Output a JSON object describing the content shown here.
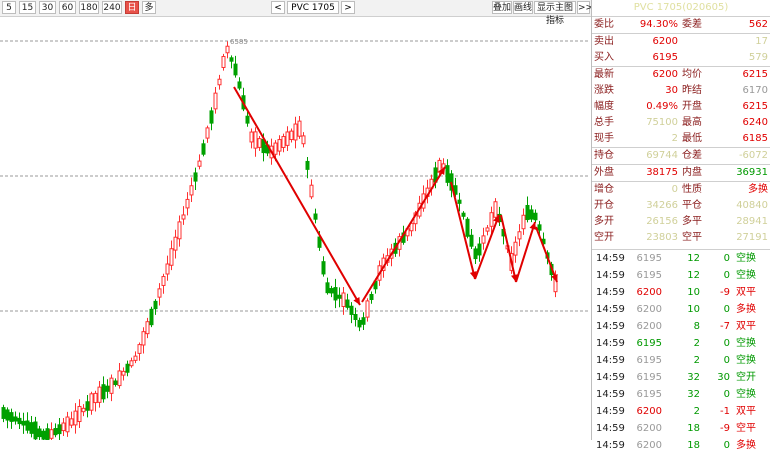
{
  "toolbar": {
    "periods": [
      {
        "label": "5",
        "active": false
      },
      {
        "label": "15",
        "active": false
      },
      {
        "label": "30",
        "active": false
      },
      {
        "label": "60",
        "active": false
      },
      {
        "label": "180",
        "active": false
      },
      {
        "label": "240",
        "active": false
      },
      {
        "label": "日",
        "active": true
      },
      {
        "label": "多",
        "active": false
      }
    ],
    "prev_symbol": "<",
    "symbol": "PVC 1705",
    "next_symbol": ">",
    "overlay_label": "叠加",
    "draw_label": "画线",
    "indicator_label": "显示主图指标",
    "expand_label": ">>"
  },
  "chart": {
    "high_marker": "6585",
    "colors": {
      "up": "#ff3030",
      "down": "#00a000",
      "trend": "#e00000",
      "grid": "#999999"
    }
  },
  "quote": {
    "title": "PVC 1705(020605)",
    "rows": [
      {
        "l1": "委比",
        "v1": "94.30%",
        "c1": "red",
        "l2": "委差",
        "v2": "562",
        "c2": "red",
        "sep": false
      },
      {
        "l1": "卖出",
        "v1": "6200",
        "c1": "red",
        "l2": "",
        "v2": "17",
        "c2": "yellow",
        "sep": true
      },
      {
        "l1": "买入",
        "v1": "6195",
        "c1": "red",
        "l2": "",
        "v2": "579",
        "c2": "yellow",
        "sep": false
      },
      {
        "l1": "最新",
        "v1": "6200",
        "c1": "red",
        "l2": "均价",
        "v2": "6215",
        "c2": "red",
        "sep": true
      },
      {
        "l1": "涨跌",
        "v1": "30",
        "c1": "red",
        "l2": "昨结",
        "v2": "6170",
        "c2": "grey",
        "sep": false
      },
      {
        "l1": "幅度",
        "v1": "0.49%",
        "c1": "red",
        "l2": "开盘",
        "v2": "6215",
        "c2": "red",
        "sep": false
      },
      {
        "l1": "总手",
        "v1": "75100",
        "c1": "yellow",
        "l2": "最高",
        "v2": "6240",
        "c2": "red",
        "sep": false
      },
      {
        "l1": "现手",
        "v1": "2",
        "c1": "yellow",
        "l2": "最低",
        "v2": "6185",
        "c2": "red",
        "sep": false
      },
      {
        "l1": "持仓",
        "v1": "69744",
        "c1": "yellow",
        "l2": "仓差",
        "v2": "-6072",
        "c2": "yellow",
        "sep": true
      },
      {
        "l1": "外盘",
        "v1": "38175",
        "c1": "red",
        "l2": "内盘",
        "v2": "36931",
        "c2": "green",
        "sep": true
      },
      {
        "l1": "增仓",
        "v1": "0",
        "c1": "yellow",
        "l2": "性质",
        "v2": "多换",
        "c2": "red",
        "sep": true
      },
      {
        "l1": "开仓",
        "v1": "34266",
        "c1": "yellow",
        "l2": "平仓",
        "v2": "40840",
        "c2": "yellow",
        "sep": false
      },
      {
        "l1": "多开",
        "v1": "26156",
        "c1": "yellow",
        "l2": "多平",
        "v2": "28941",
        "c2": "yellow",
        "sep": false
      },
      {
        "l1": "空开",
        "v1": "23803",
        "c1": "yellow",
        "l2": "空平",
        "v2": "27191",
        "c2": "yellow",
        "sep": false
      }
    ]
  },
  "ticks": [
    {
      "time": "14:59",
      "price": "6195",
      "pc": "grey",
      "vol": "12",
      "chg": "0",
      "type": "空换",
      "tc": "green"
    },
    {
      "time": "14:59",
      "price": "6195",
      "pc": "grey",
      "vol": "12",
      "chg": "0",
      "type": "空换",
      "tc": "green"
    },
    {
      "time": "14:59",
      "price": "6200",
      "pc": "red",
      "vol": "10",
      "chg": "-9",
      "type": "双平",
      "tc": "red"
    },
    {
      "time": "14:59",
      "price": "6200",
      "pc": "grey",
      "vol": "10",
      "chg": "0",
      "type": "多换",
      "tc": "red"
    },
    {
      "time": "14:59",
      "price": "6200",
      "pc": "grey",
      "vol": "8",
      "chg": "-7",
      "type": "双平",
      "tc": "red"
    },
    {
      "time": "14:59",
      "price": "6195",
      "pc": "green",
      "vol": "2",
      "chg": "0",
      "type": "空换",
      "tc": "green"
    },
    {
      "time": "14:59",
      "price": "6195",
      "pc": "grey",
      "vol": "2",
      "chg": "0",
      "type": "空换",
      "tc": "green"
    },
    {
      "time": "14:59",
      "price": "6195",
      "pc": "grey",
      "vol": "32",
      "chg": "30",
      "type": "空开",
      "tc": "green"
    },
    {
      "time": "14:59",
      "price": "6195",
      "pc": "grey",
      "vol": "32",
      "chg": "0",
      "type": "空换",
      "tc": "green"
    },
    {
      "time": "14:59",
      "price": "6200",
      "pc": "red",
      "vol": "2",
      "chg": "-1",
      "type": "双平",
      "tc": "red"
    },
    {
      "time": "14:59",
      "price": "6200",
      "pc": "grey",
      "vol": "18",
      "chg": "-9",
      "type": "空平",
      "tc": "red"
    },
    {
      "time": "14:59",
      "price": "6200",
      "pc": "grey",
      "vol": "18",
      "chg": "0",
      "type": "多换",
      "tc": "red"
    }
  ]
}
